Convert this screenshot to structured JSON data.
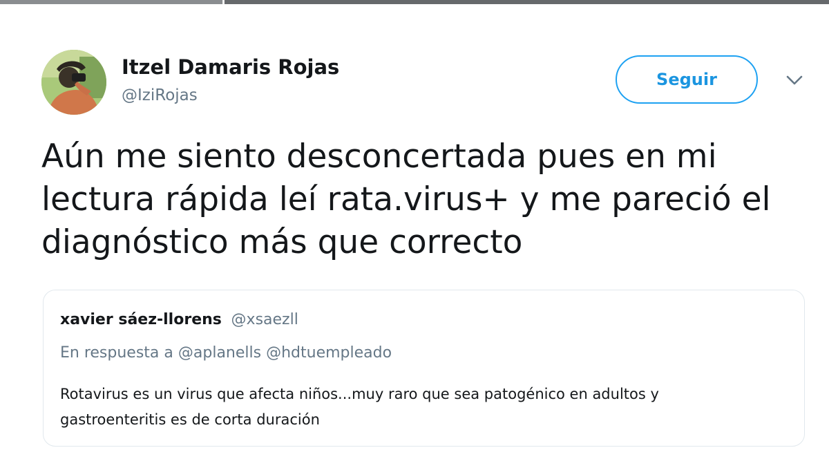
{
  "tweet": {
    "author": {
      "display_name": "Itzel Damaris Rojas",
      "handle": "@IziRojas"
    },
    "follow_label": "Seguir",
    "menu_icon": "chevron-down-icon",
    "text": "Aún me siento desconcertada pues en mi\nlectura rápida leí rata.virus+ y me pareció el\ndiagnóstico más que correcto"
  },
  "quoted_tweet": {
    "author_name": "xavier sáez-llorens",
    "author_handle": "@xsaezll",
    "reply_prefix": "En respuesta a",
    "reply_to": "@aplanells @hdtuempleado",
    "text": "Rotavirus es un virus que afecta niños...muy raro que sea patogénico en adultos y\ngastroenteritis es de corta duración"
  },
  "colors": {
    "accent": "#1da1f2",
    "text_primary": "#14171a",
    "text_secondary": "#657786",
    "border": "#e1e8ed"
  }
}
